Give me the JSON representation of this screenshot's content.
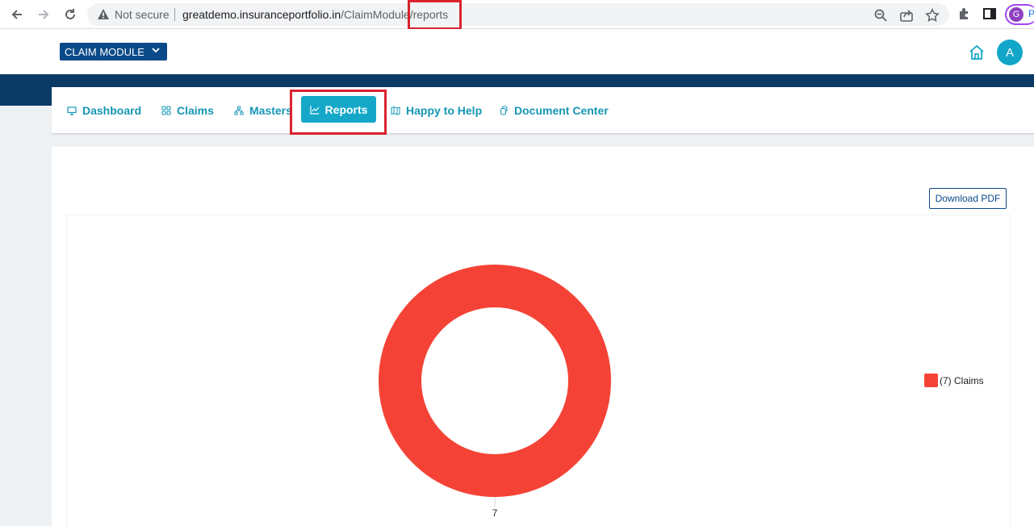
{
  "browser": {
    "security_label": "Not secure",
    "url_host": "greatdemo.insuranceportfolio.in",
    "url_path": "/ClaimModule/reports",
    "profile_initial": "G",
    "profile_more": "P"
  },
  "header": {
    "module_label": "CLAIM MODULE",
    "user_initial": "A"
  },
  "tabs": [
    {
      "label": "Dashboard",
      "icon": "monitor-icon"
    },
    {
      "label": "Claims",
      "icon": "grid-icon"
    },
    {
      "label": "Masters",
      "icon": "hierarchy-icon"
    },
    {
      "label": "Reports",
      "icon": "line-chart-icon",
      "active": true
    },
    {
      "label": "Happy to Help",
      "icon": "map-icon"
    },
    {
      "label": "Document Center",
      "icon": "copy-icon"
    }
  ],
  "report": {
    "download_label": "Download PDF"
  },
  "colors": {
    "brand_dark": "#0a4a8a",
    "band": "#0b3a66",
    "tab_text": "#1597b6",
    "tab_active_bg": "#15a7c8",
    "highlight": "#d9232e",
    "donut": "#f44336"
  },
  "chart_data": {
    "type": "pie",
    "variant": "donut",
    "labels": [
      "Claims"
    ],
    "values": [
      7
    ],
    "legend_entries": [
      "(7)  Claims"
    ],
    "data_labels": [
      "7"
    ],
    "legend_position": "right"
  }
}
